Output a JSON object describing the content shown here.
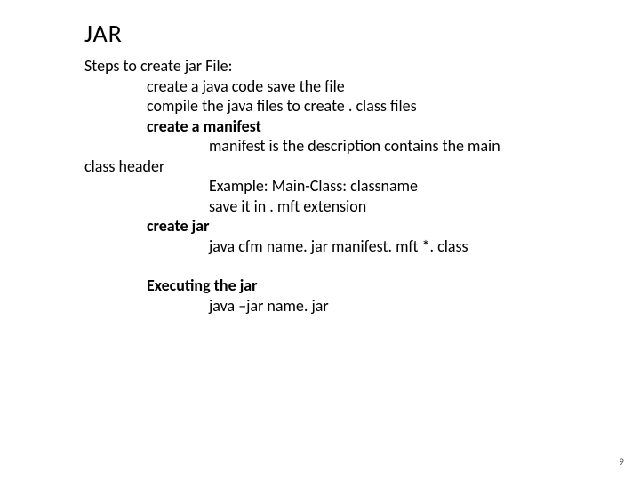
{
  "title": "JAR",
  "lines": {
    "l1": "Steps to create jar File:",
    "l2": "create a java code save the file",
    "l3": "compile the java files to create . class files",
    "l4": "create a manifest",
    "l5a": "manifest is the description contains the main",
    "l5b": "class header",
    "l6": "Example: Main-Class: classname",
    "l7": "save it in . mft extension",
    "l8": "create jar",
    "l9": "java cfm name. jar manifest. mft *. class",
    "l10": "Executing the jar",
    "l11": "java –jar name. jar"
  },
  "page_number": "9"
}
